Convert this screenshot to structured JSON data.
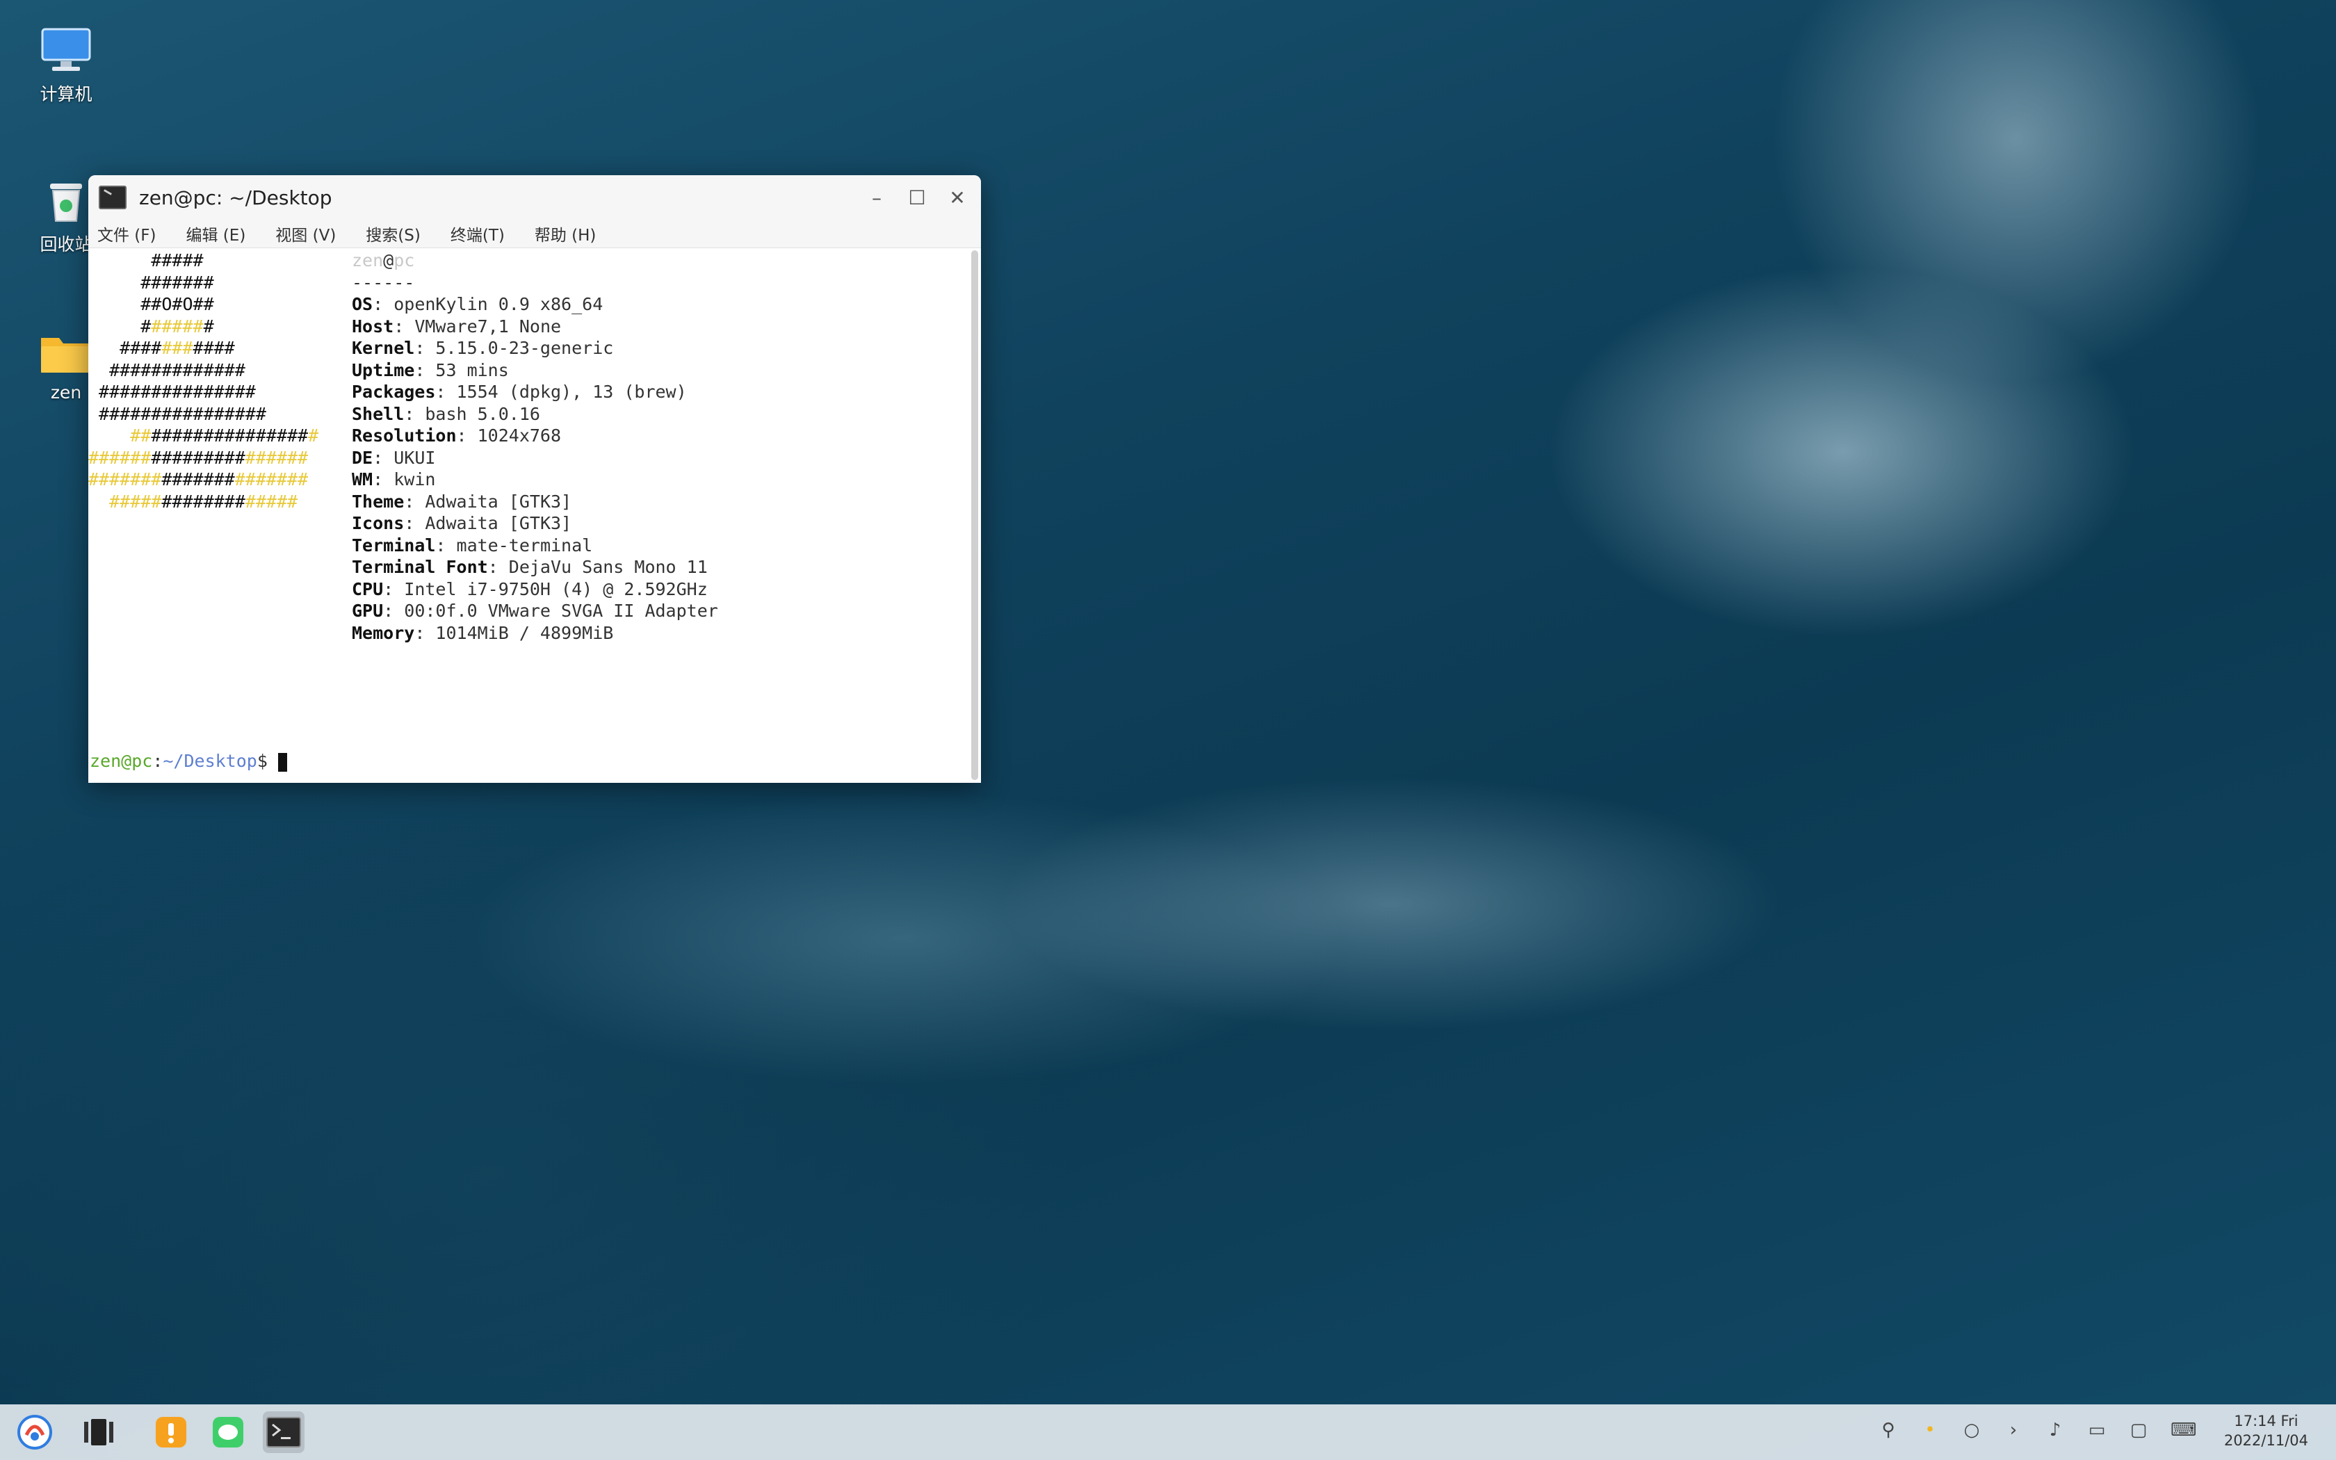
{
  "desktop": {
    "icons": [
      {
        "label": "计算机",
        "icon": "computer-icon"
      },
      {
        "label": "回收站",
        "icon": "trash-icon"
      },
      {
        "label": "zen",
        "icon": "home-folder-icon"
      }
    ]
  },
  "window": {
    "title": "zen@pc: ~/Desktop",
    "menus": [
      "文件 (F)",
      "编辑 (E)",
      "视图 (V)",
      "搜索(S)",
      "终端(T)",
      "帮助 (H)"
    ]
  },
  "neofetch": {
    "logo": [
      [
        "",
        "      #####",
        ""
      ],
      [
        "",
        "     #######",
        ""
      ],
      [
        "",
        "     ##O#O##",
        ""
      ],
      [
        "",
        "     #",
        "#####",
        "#"
      ],
      [
        "",
        "   ####",
        "###",
        "####"
      ],
      [
        "",
        "  #############",
        ""
      ],
      [
        "",
        " ###############",
        ""
      ],
      [
        "",
        " ################",
        ""
      ],
      [
        "",
        "",
        "##",
        "###############",
        "#"
      ],
      [
        "",
        "",
        "######",
        "#########",
        "######"
      ],
      [
        "",
        "",
        "#######",
        "#######",
        "#######"
      ],
      [
        "",
        "",
        "#####",
        "########",
        "#####"
      ]
    ],
    "header_user": "zen",
    "header_at": "@",
    "header_host": "pc",
    "separator": "------",
    "rows": [
      {
        "key": "OS",
        "value": "openKylin 0.9 x86_64"
      },
      {
        "key": "Host",
        "value": "VMware7,1 None"
      },
      {
        "key": "Kernel",
        "value": "5.15.0-23-generic"
      },
      {
        "key": "Uptime",
        "value": "53 mins"
      },
      {
        "key": "Packages",
        "value": "1554 (dpkg), 13 (brew)"
      },
      {
        "key": "Shell",
        "value": "bash 5.0.16"
      },
      {
        "key": "Resolution",
        "value": "1024x768"
      },
      {
        "key": "DE",
        "value": "UKUI"
      },
      {
        "key": "WM",
        "value": "kwin"
      },
      {
        "key": "Theme",
        "value": "Adwaita [GTK3]"
      },
      {
        "key": "Icons",
        "value": "Adwaita [GTK3]"
      },
      {
        "key": "Terminal",
        "value": "mate-terminal"
      },
      {
        "key": "Terminal Font",
        "value": "DejaVu Sans Mono 11"
      },
      {
        "key": "CPU",
        "value": "Intel i7-9750H (4) @ 2.592GHz"
      },
      {
        "key": "GPU",
        "value": "00:0f.0 VMware SVGA II Adapter"
      },
      {
        "key": "Memory",
        "value": "1014MiB / 4899MiB"
      }
    ],
    "colors_dark": [
      "#2e3436",
      "#cc1f1f",
      "#4e9a06",
      "#c4a000",
      "#3465a4",
      "#75507b",
      "#06989a",
      "#d3d7cf"
    ],
    "colors_bright": [
      "#555753",
      "#ef2929",
      "#8ae234",
      "#fce94f",
      "#729fcf",
      "#ad7fa8",
      "#34e2e2",
      "#eeeeec"
    ]
  },
  "prompt": {
    "user_host": "zen@pc",
    "sep": ":",
    "path": "~/Desktop",
    "symbol": "$ "
  },
  "taskbar": {
    "apps": [
      "start-menu-icon",
      "multitask-view-icon",
      "software-store-icon",
      "wechat-icon",
      "terminal-icon"
    ],
    "tray": [
      "network-icon",
      "notification-dot-icon",
      "search-icon",
      "expand-arrow-icon",
      "volume-icon",
      "display-icon",
      "chat-icon",
      "keyboard-icon"
    ],
    "tray_glyphs": [
      "⚲",
      "•",
      "○",
      "›",
      "♪",
      "▭",
      "▢",
      "⌨"
    ],
    "time": "17:14 Fri",
    "date": "2022/11/04"
  }
}
